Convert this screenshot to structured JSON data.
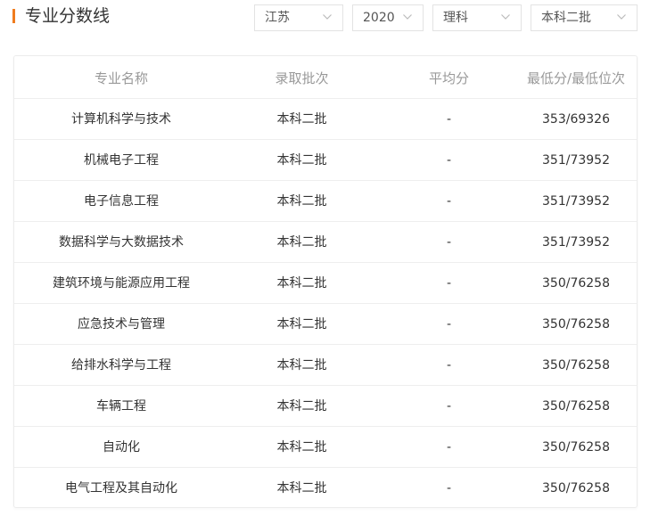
{
  "header": {
    "title": "专业分数线"
  },
  "filters": {
    "province": "江苏",
    "year": "2020",
    "subject": "理科",
    "batch": "本科二批"
  },
  "table": {
    "columns": [
      "专业名称",
      "录取批次",
      "平均分",
      "最低分/最低位次"
    ],
    "rows": [
      {
        "major": "计算机科学与技术",
        "batch": "本科二批",
        "avg": "-",
        "min": "353/69326"
      },
      {
        "major": "机械电子工程",
        "batch": "本科二批",
        "avg": "-",
        "min": "351/73952"
      },
      {
        "major": "电子信息工程",
        "batch": "本科二批",
        "avg": "-",
        "min": "351/73952"
      },
      {
        "major": "数据科学与大数据技术",
        "batch": "本科二批",
        "avg": "-",
        "min": "351/73952"
      },
      {
        "major": "建筑环境与能源应用工程",
        "batch": "本科二批",
        "avg": "-",
        "min": "350/76258"
      },
      {
        "major": "应急技术与管理",
        "batch": "本科二批",
        "avg": "-",
        "min": "350/76258"
      },
      {
        "major": "给排水科学与工程",
        "batch": "本科二批",
        "avg": "-",
        "min": "350/76258"
      },
      {
        "major": "车辆工程",
        "batch": "本科二批",
        "avg": "-",
        "min": "350/76258"
      },
      {
        "major": "自动化",
        "batch": "本科二批",
        "avg": "-",
        "min": "350/76258"
      },
      {
        "major": "电气工程及其自动化",
        "batch": "本科二批",
        "avg": "-",
        "min": "350/76258"
      }
    ]
  },
  "colors": {
    "accent": "#f07c1e",
    "header_text": "#999999",
    "border": "#eeeeee"
  }
}
